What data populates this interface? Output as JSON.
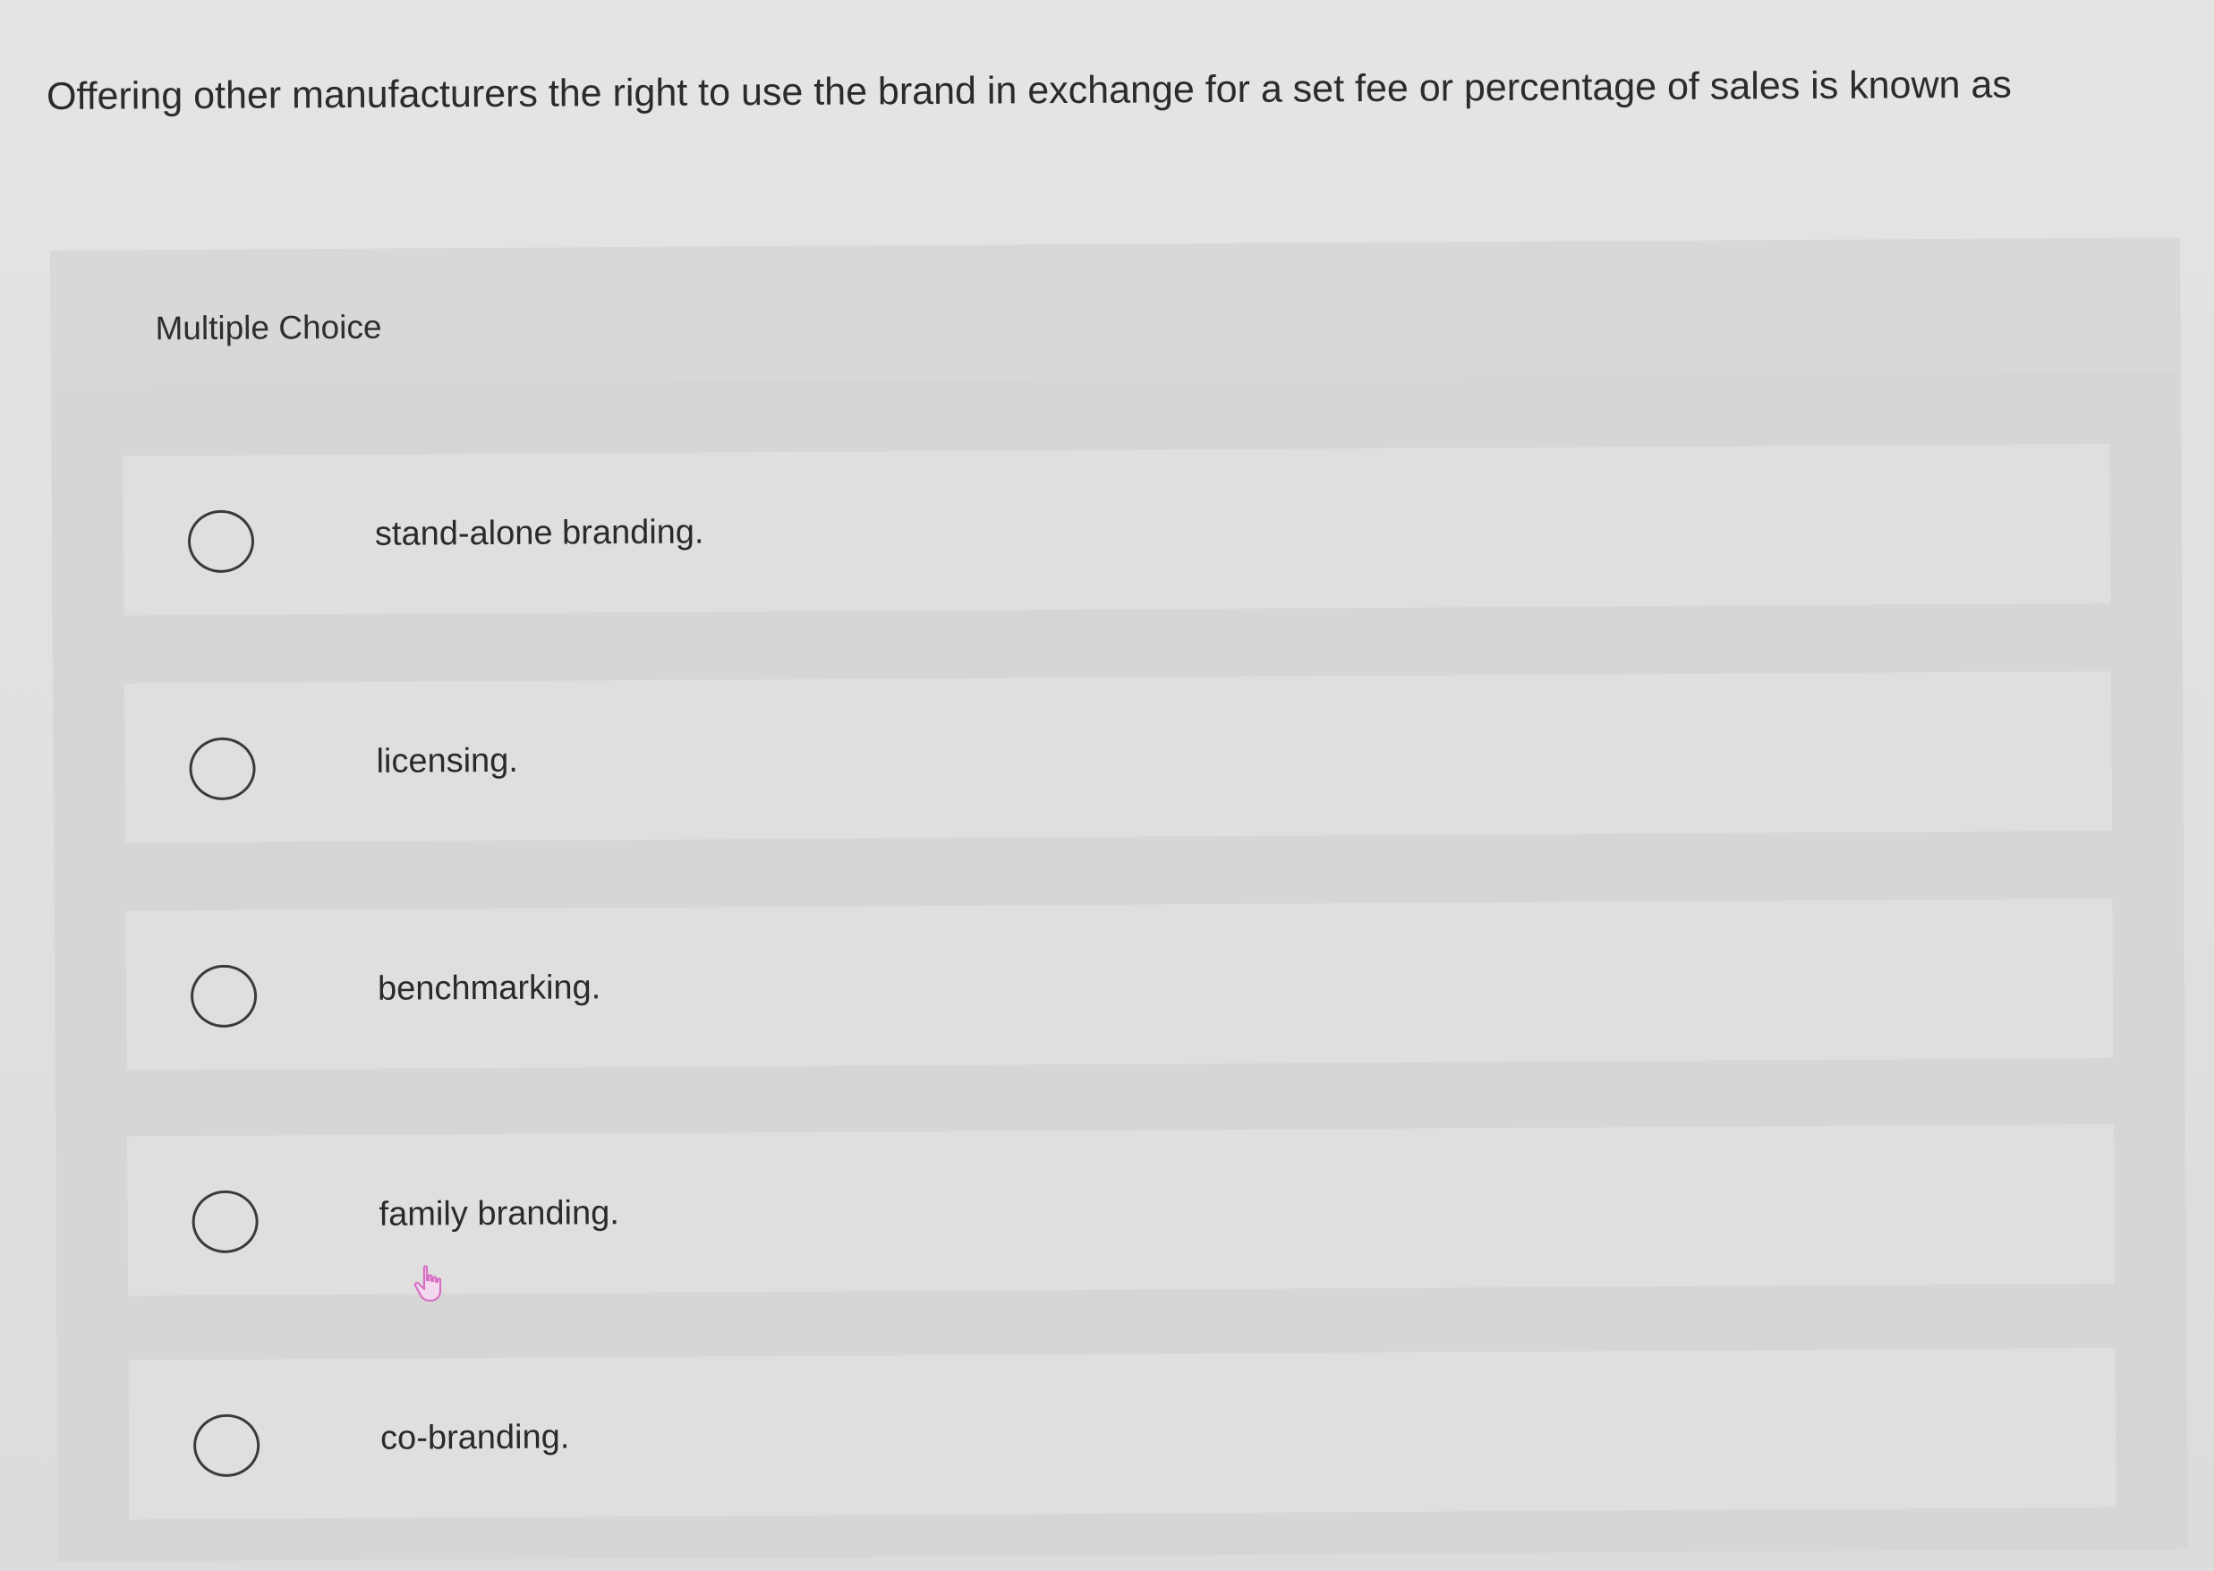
{
  "question": {
    "text": "Offering other manufacturers the right to use the brand in exchange for a set fee or percentage of sales is known as"
  },
  "choices": {
    "header": "Multiple Choice",
    "options": [
      {
        "label": "stand-alone branding."
      },
      {
        "label": "licensing."
      },
      {
        "label": "benchmarking."
      },
      {
        "label": "family branding."
      },
      {
        "label": "co-branding."
      }
    ]
  },
  "colors": {
    "background": "#e1e1e1",
    "panel": "#d6d6d6",
    "option": "#dfdfdf",
    "text": "#2a2a2a",
    "cursor": "#d86fc2"
  },
  "icons": {
    "cursor": "hand-pointer-icon"
  }
}
